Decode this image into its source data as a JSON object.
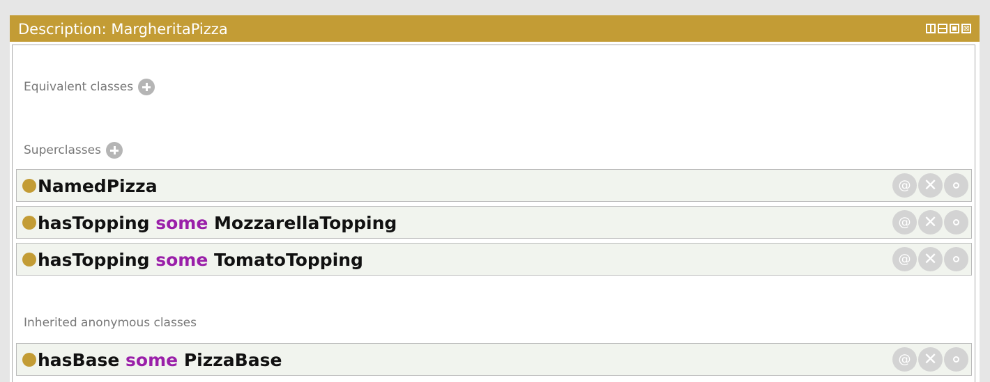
{
  "view": {
    "title": "Description: MargheritaPizza",
    "controls": [
      "split-vertical",
      "split-horizontal",
      "maximize",
      "close"
    ],
    "close_glyph": "⊠"
  },
  "sections": {
    "equivalent": {
      "label": "Equivalent classes"
    },
    "superclasses": {
      "label": "Superclasses",
      "rows": [
        {
          "subject": "NamedPizza",
          "keyword": "",
          "object": ""
        },
        {
          "subject": "hasTopping",
          "keyword": "some",
          "object": "MozzarellaTopping"
        },
        {
          "subject": "hasTopping",
          "keyword": "some",
          "object": "TomatoTopping"
        }
      ]
    },
    "inherited": {
      "label": "Inherited anonymous classes",
      "rows": [
        {
          "subject": "hasBase",
          "keyword": "some",
          "object": "PizzaBase"
        }
      ]
    }
  },
  "row_actions": {
    "annotate": "@",
    "delete": "✕"
  },
  "colors": {
    "title_bar": "#c39c35",
    "keyword": "#9a1fa9",
    "row_background": "#f1f4ee",
    "bullet": "#c39c35"
  }
}
